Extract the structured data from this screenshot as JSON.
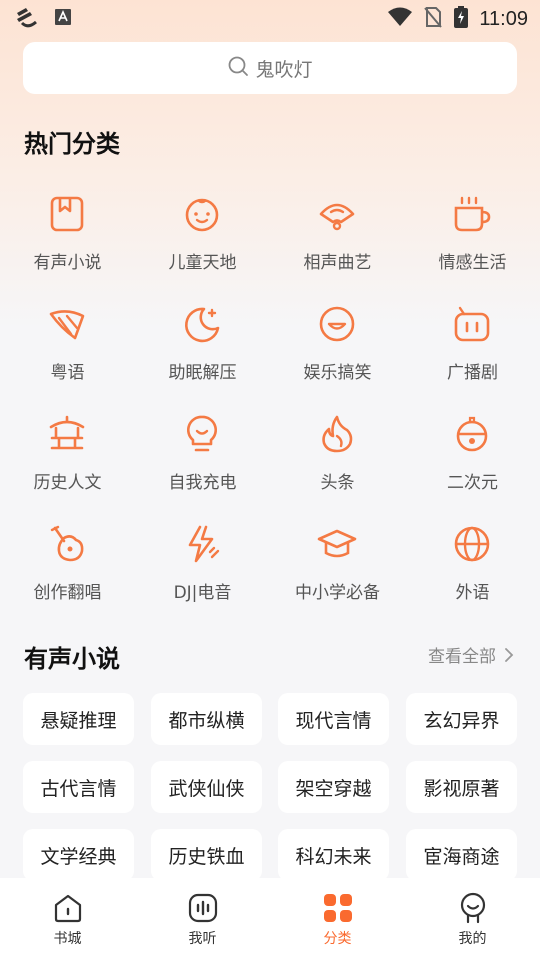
{
  "status_bar": {
    "time": "11:09"
  },
  "search": {
    "placeholder_text": "鬼吹灯"
  },
  "hot_section": {
    "title": "热门分类",
    "categories": [
      {
        "label": "有声小说",
        "icon": "book-icon"
      },
      {
        "label": "儿童天地",
        "icon": "child-face-icon"
      },
      {
        "label": "相声曲艺",
        "icon": "fan-icon"
      },
      {
        "label": "情感生活",
        "icon": "coffee-cup-icon"
      },
      {
        "label": "粤语",
        "icon": "cantonese-icon"
      },
      {
        "label": "助眠解压",
        "icon": "moon-icon"
      },
      {
        "label": "娱乐搞笑",
        "icon": "smile-icon"
      },
      {
        "label": "广播剧",
        "icon": "radio-icon"
      },
      {
        "label": "历史人文",
        "icon": "pavilion-icon"
      },
      {
        "label": "自我充电",
        "icon": "lightbulb-icon"
      },
      {
        "label": "头条",
        "icon": "flame-icon"
      },
      {
        "label": "二次元",
        "icon": "bell-icon"
      },
      {
        "label": "创作翻唱",
        "icon": "guitar-icon"
      },
      {
        "label": "DJ|电音",
        "icon": "lightning-icon"
      },
      {
        "label": "中小学必备",
        "icon": "graduation-cap-icon"
      },
      {
        "label": "外语",
        "icon": "globe-icon"
      }
    ]
  },
  "novel_section": {
    "title": "有声小说",
    "more_label": "查看全部",
    "chips": [
      "悬疑推理",
      "都市纵横",
      "现代言情",
      "玄幻异界",
      "古代言情",
      "武侠仙侠",
      "架空穿越",
      "影视原著",
      "文学经典",
      "历史铁血",
      "科幻未来",
      "宦海商途"
    ]
  },
  "bottom_nav": {
    "items": [
      {
        "label": "书城",
        "icon": "house-icon"
      },
      {
        "label": "我听",
        "icon": "audio-wave-icon"
      },
      {
        "label": "分类",
        "icon": "grid-icon"
      },
      {
        "label": "我的",
        "icon": "profile-icon"
      }
    ],
    "active_index": 2
  },
  "colors": {
    "accent": "#fa6a2f",
    "icon_orange": "#f47a44",
    "background": "#f6f6f8"
  }
}
